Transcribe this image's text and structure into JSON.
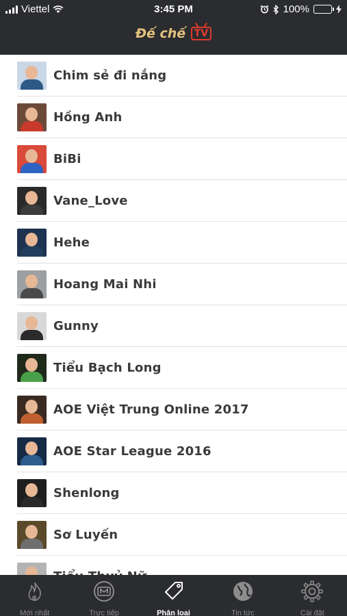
{
  "status_bar": {
    "carrier": "Viettel",
    "time": "3:45 PM",
    "battery": "100%"
  },
  "header": {
    "brand_text": "Đế chế",
    "brand_badge": "TV"
  },
  "list": {
    "items": [
      {
        "name": "Chim sẻ đi nắng",
        "bg": "#c9d7e6",
        "shirt": "#2b5a86"
      },
      {
        "name": "Hồng Anh",
        "bg": "#6b4a3a",
        "shirt": "#c83a2b"
      },
      {
        "name": "BiBi",
        "bg": "#d94a3a",
        "shirt": "#2e63c4"
      },
      {
        "name": "Vane_Love",
        "bg": "#2a2a2a",
        "shirt": "#3c3c3c"
      },
      {
        "name": "Hehe",
        "bg": "#1d3350",
        "shirt": "#22405e"
      },
      {
        "name": "Hoang Mai Nhi",
        "bg": "#9ca0a3",
        "shirt": "#4a4a4a"
      },
      {
        "name": "Gunny",
        "bg": "#d8d8d8",
        "shirt": "#2b2b2b"
      },
      {
        "name": "Tiểu Bạch Long",
        "bg": "#1f2a1b",
        "shirt": "#4aa04a"
      },
      {
        "name": "AOE Việt Trung Online 2017",
        "bg": "#3a2a22",
        "shirt": "#c06030"
      },
      {
        "name": "AOE Star League 2016",
        "bg": "#152a45",
        "shirt": "#2c5d8c"
      },
      {
        "name": "Shenlong",
        "bg": "#1e1e1e",
        "shirt": "#2a2a2a"
      },
      {
        "name": "Sơ Luyến",
        "bg": "#5a4a2a",
        "shirt": "#6e6e6e"
      },
      {
        "name": "Tiểu Thuỷ Nữ",
        "bg": "#b4b4b4",
        "shirt": "#5a5a5a"
      }
    ]
  },
  "tabs": [
    {
      "label": "Mới nhất",
      "icon": "flame-icon",
      "active": false
    },
    {
      "label": "Trực tiếp",
      "icon": "live-tv-icon",
      "active": false
    },
    {
      "label": "Phân loại",
      "icon": "tag-icon",
      "active": true
    },
    {
      "label": "Tin tức",
      "icon": "globe-icon",
      "active": false
    },
    {
      "label": "Cài đặt",
      "icon": "gear-icon",
      "active": false
    }
  ]
}
